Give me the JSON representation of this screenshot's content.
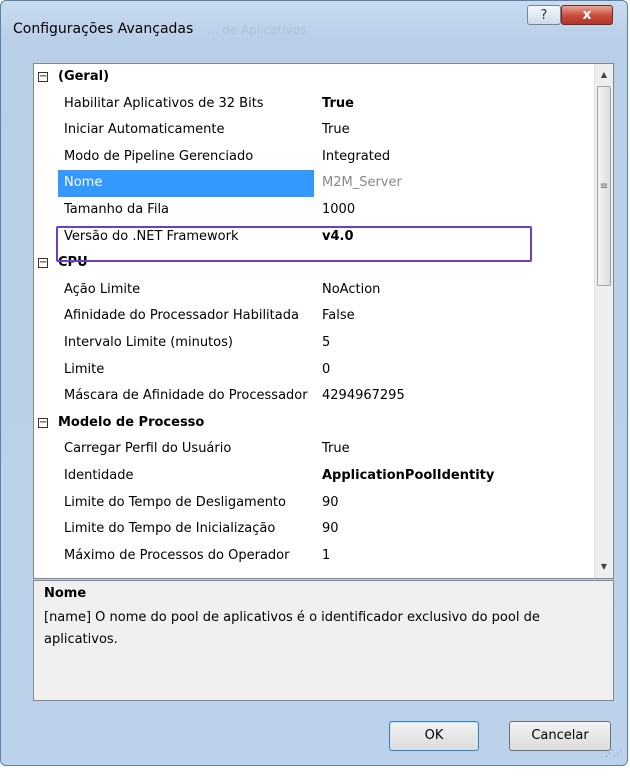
{
  "window": {
    "title": "Configurações Avançadas",
    "ghost_title": "... de Aplicativos",
    "help_label": "?",
    "close_label": "x"
  },
  "grid": {
    "categories": [
      {
        "label": "(Geral)",
        "toggle": "⊟",
        "properties": [
          {
            "name": "Habilitar Aplicativos de 32 Bits",
            "value": "True"
          },
          {
            "name": "Iniciar Automaticamente",
            "value": "True"
          },
          {
            "name": "Modo de Pipeline Gerenciado",
            "value": "Integrated"
          },
          {
            "name": "Nome",
            "value": "M2M_Server"
          },
          {
            "name": "Tamanho da Fila",
            "value": "1000"
          },
          {
            "name": "Versão do .NET Framework",
            "value": "v4.0"
          }
        ]
      },
      {
        "label": "CPU",
        "toggle": "⊟",
        "properties": [
          {
            "name": "Ação Limite",
            "value": "NoAction"
          },
          {
            "name": "Afinidade do Processador Habilitada",
            "value": "False"
          },
          {
            "name": "Intervalo Limite (minutos)",
            "value": "5"
          },
          {
            "name": "Limite",
            "value": "0"
          },
          {
            "name": "Máscara de Afinidade do Processador",
            "value": "4294967295"
          }
        ]
      },
      {
        "label": "Modelo de Processo",
        "toggle": "⊟",
        "properties": [
          {
            "name": "Carregar Perfil do Usuário",
            "value": "True"
          },
          {
            "name": "Identidade",
            "value": "ApplicationPoolIdentity"
          },
          {
            "name": "Limite do Tempo de Desligamento",
            "value": "90"
          },
          {
            "name": "Limite do Tempo de Inicialização",
            "value": "90"
          },
          {
            "name": "Máximo de Processos do Operador",
            "value": "1"
          }
        ]
      }
    ],
    "scroll_up": "▲",
    "scroll_down": "▼",
    "scroll_grip": "≡"
  },
  "description": {
    "title": "Nome",
    "text": "[name] O nome do pool de aplicativos é o identificador exclusivo do pool de aplicativos."
  },
  "buttons": {
    "ok": "OK",
    "cancel": "Cancelar"
  },
  "colors": {
    "selection": "#3399ff",
    "highlight_border": "#6a3ec9"
  }
}
